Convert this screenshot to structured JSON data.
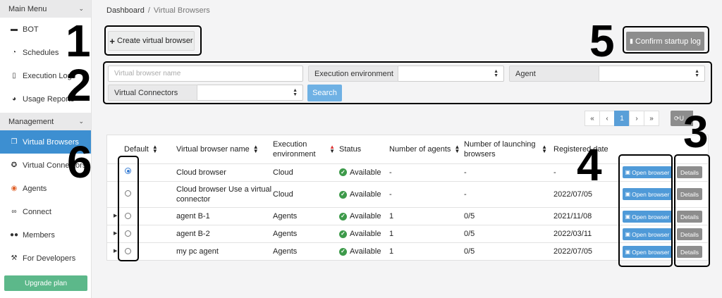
{
  "sidebar": {
    "sections": [
      {
        "label": "Main Menu"
      },
      {
        "label": "Management"
      }
    ],
    "main_items": [
      {
        "label": "BOT",
        "icon": "robot-icon"
      },
      {
        "label": "Schedules",
        "icon": "clock-icon"
      },
      {
        "label": "Execution Logs",
        "icon": "document-icon"
      },
      {
        "label": "Usage Reports",
        "icon": "pie-chart-icon"
      }
    ],
    "mgmt_items": [
      {
        "label": "Virtual Browsers",
        "icon": "window-stack-icon",
        "active": true
      },
      {
        "label": "Virtual Connectors",
        "icon": "plug-icon"
      },
      {
        "label": "Agents",
        "icon": "agent-icon"
      },
      {
        "label": "Connect",
        "icon": "link-icon"
      },
      {
        "label": "Members",
        "icon": "users-icon"
      },
      {
        "label": "For Developers",
        "icon": "wrench-icon"
      }
    ],
    "upgrade_label": "Upgrade plan"
  },
  "breadcrumb": {
    "root": "Dashboard",
    "current": "Virtual Browsers"
  },
  "toolbar": {
    "create_label": "Create virtual browser",
    "confirm_label": "Confirm startup log"
  },
  "filters": {
    "name_placeholder": "Virtual browser name",
    "exec_env_label": "Execution environment",
    "agent_label": "Agent",
    "connectors_label": "Virtual Connectors",
    "search_label": "Search"
  },
  "pagination": {
    "first": "«",
    "prev": "‹",
    "current": "1",
    "next": "›",
    "last": "»",
    "update_label": "U"
  },
  "table": {
    "columns": {
      "default": "Default",
      "name": "Virtual browser name",
      "exec_env_1": "Execution",
      "exec_env_2": "environment",
      "status": "Status",
      "num_agents": "Number of agents",
      "launching_1": "Number of launching",
      "launching_2": "browsers",
      "registered": "Registered date"
    },
    "rows": [
      {
        "name": "Cloud browser",
        "name2": "",
        "env": "Cloud",
        "status": "Available",
        "agents": "-",
        "launching": "-",
        "date": "-",
        "selected": true
      },
      {
        "name": "Cloud browser Use a virtual",
        "name2": "connector",
        "env": "Cloud",
        "status": "Available",
        "agents": "-",
        "launching": "-",
        "date": "2022/07/05",
        "selected": false
      },
      {
        "name": "agent B-1",
        "name2": "",
        "env": "Agents",
        "status": "Available",
        "agents": "1",
        "launching": "0/5",
        "date": "2021/11/08",
        "selected": false
      },
      {
        "name": "agent B-2",
        "name2": "",
        "env": "Agents",
        "status": "Available",
        "agents": "1",
        "launching": "0/5",
        "date": "2022/03/11",
        "selected": false
      },
      {
        "name": "my pc agent",
        "name2": "",
        "env": "Agents",
        "status": "Available",
        "agents": "1",
        "launching": "0/5",
        "date": "2022/07/05",
        "selected": false
      }
    ],
    "open_label": "Open browser",
    "details_label": "Details"
  },
  "annotations": [
    "1",
    "2",
    "3",
    "4",
    "5",
    "6"
  ],
  "colors": {
    "accent": "#3d8fd1",
    "upgrade": "#5cb88a",
    "available": "#3d9a4a",
    "gray_button": "#8d8d8d"
  }
}
